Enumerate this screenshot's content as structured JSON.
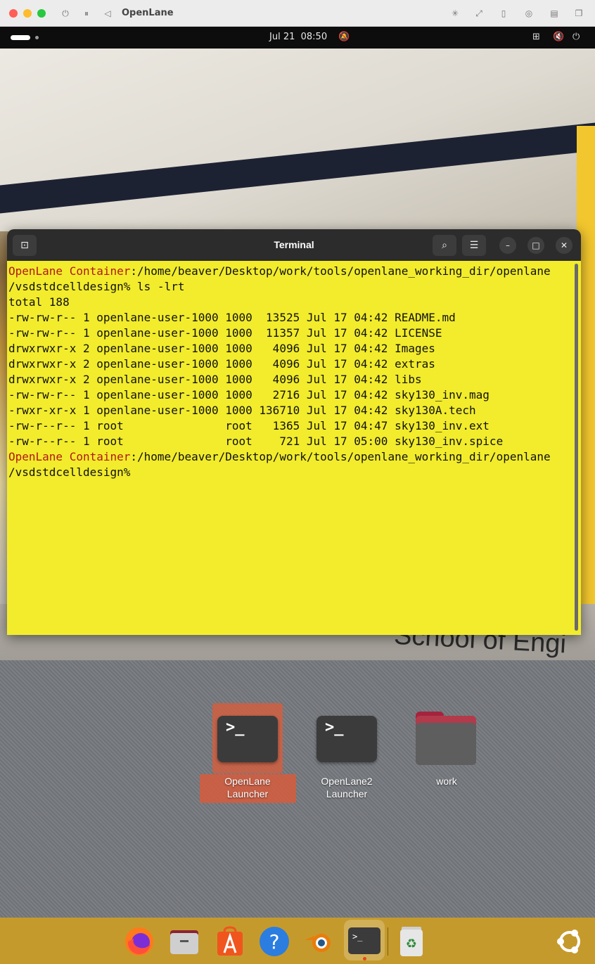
{
  "host": {
    "title": "OpenLane",
    "icons": [
      "power-icon",
      "pause-icon",
      "back-icon",
      "brightness-icon",
      "resize-icon",
      "usb-icon",
      "disc-icon",
      "folder-share-icon",
      "windows-icon"
    ]
  },
  "top_panel": {
    "date": "Jul 21",
    "time": "08:50",
    "icons": [
      "bell-muted-icon",
      "network-icon",
      "volume-muted-icon",
      "power-icon"
    ]
  },
  "terminal": {
    "title": "Terminal",
    "lines": [
      {
        "prompt": "OpenLane Container",
        "text": ":/home/beaver/Desktop/work/tools/openlane_working_dir/openlane"
      },
      {
        "prompt": "",
        "text": "/vsdstdcelldesign% ls -lrt"
      },
      {
        "prompt": "",
        "text": "total 188"
      },
      {
        "prompt": "",
        "text": "-rw-rw-r-- 1 openlane-user-1000 1000  13525 Jul 17 04:42 README.md"
      },
      {
        "prompt": "",
        "text": "-rw-rw-r-- 1 openlane-user-1000 1000  11357 Jul 17 04:42 LICENSE"
      },
      {
        "prompt": "",
        "text": "drwxrwxr-x 2 openlane-user-1000 1000   4096 Jul 17 04:42 Images"
      },
      {
        "prompt": "",
        "text": "drwxrwxr-x 2 openlane-user-1000 1000   4096 Jul 17 04:42 extras"
      },
      {
        "prompt": "",
        "text": "drwxrwxr-x 2 openlane-user-1000 1000   4096 Jul 17 04:42 libs"
      },
      {
        "prompt": "",
        "text": "-rw-rw-r-- 1 openlane-user-1000 1000   2716 Jul 17 04:42 sky130_inv.mag"
      },
      {
        "prompt": "",
        "text": "-rwxr-xr-x 1 openlane-user-1000 1000 136710 Jul 17 04:42 sky130A.tech"
      },
      {
        "prompt": "",
        "text": "-rw-r--r-- 1 root               root   1365 Jul 17 04:47 sky130_inv.ext"
      },
      {
        "prompt": "",
        "text": "-rw-r--r-- 1 root               root    721 Jul 17 05:00 sky130_inv.spice"
      },
      {
        "prompt": "OpenLane Container",
        "text": ":/home/beaver/Desktop/work/tools/openlane_working_dir/openlane"
      },
      {
        "prompt": "",
        "text": "/vsdstdcelldesign%"
      }
    ]
  },
  "wallpaper": {
    "text": "School of Engi"
  },
  "desktop_icons": [
    {
      "line1": "OpenLane",
      "line2": "Launcher",
      "glyph": ">_",
      "selected": true
    },
    {
      "line1": "OpenLane2",
      "line2": "Launcher",
      "glyph": ">_",
      "selected": false
    },
    {
      "line1": "work",
      "line2": "",
      "glyph": "folder-icon",
      "selected": false
    }
  ],
  "dock": {
    "apps": [
      "firefox-icon",
      "files-icon",
      "app-center-icon",
      "help-icon",
      "blender-icon",
      "terminal-icon",
      "trash-icon"
    ],
    "active": "terminal-icon",
    "show_apps": "show-apps-icon"
  },
  "colors": {
    "terminal_bg": "#f2ec2c",
    "prompt_red": "#b21818",
    "dock_bg": "#c59a2c",
    "selection": "#d65c3c"
  }
}
